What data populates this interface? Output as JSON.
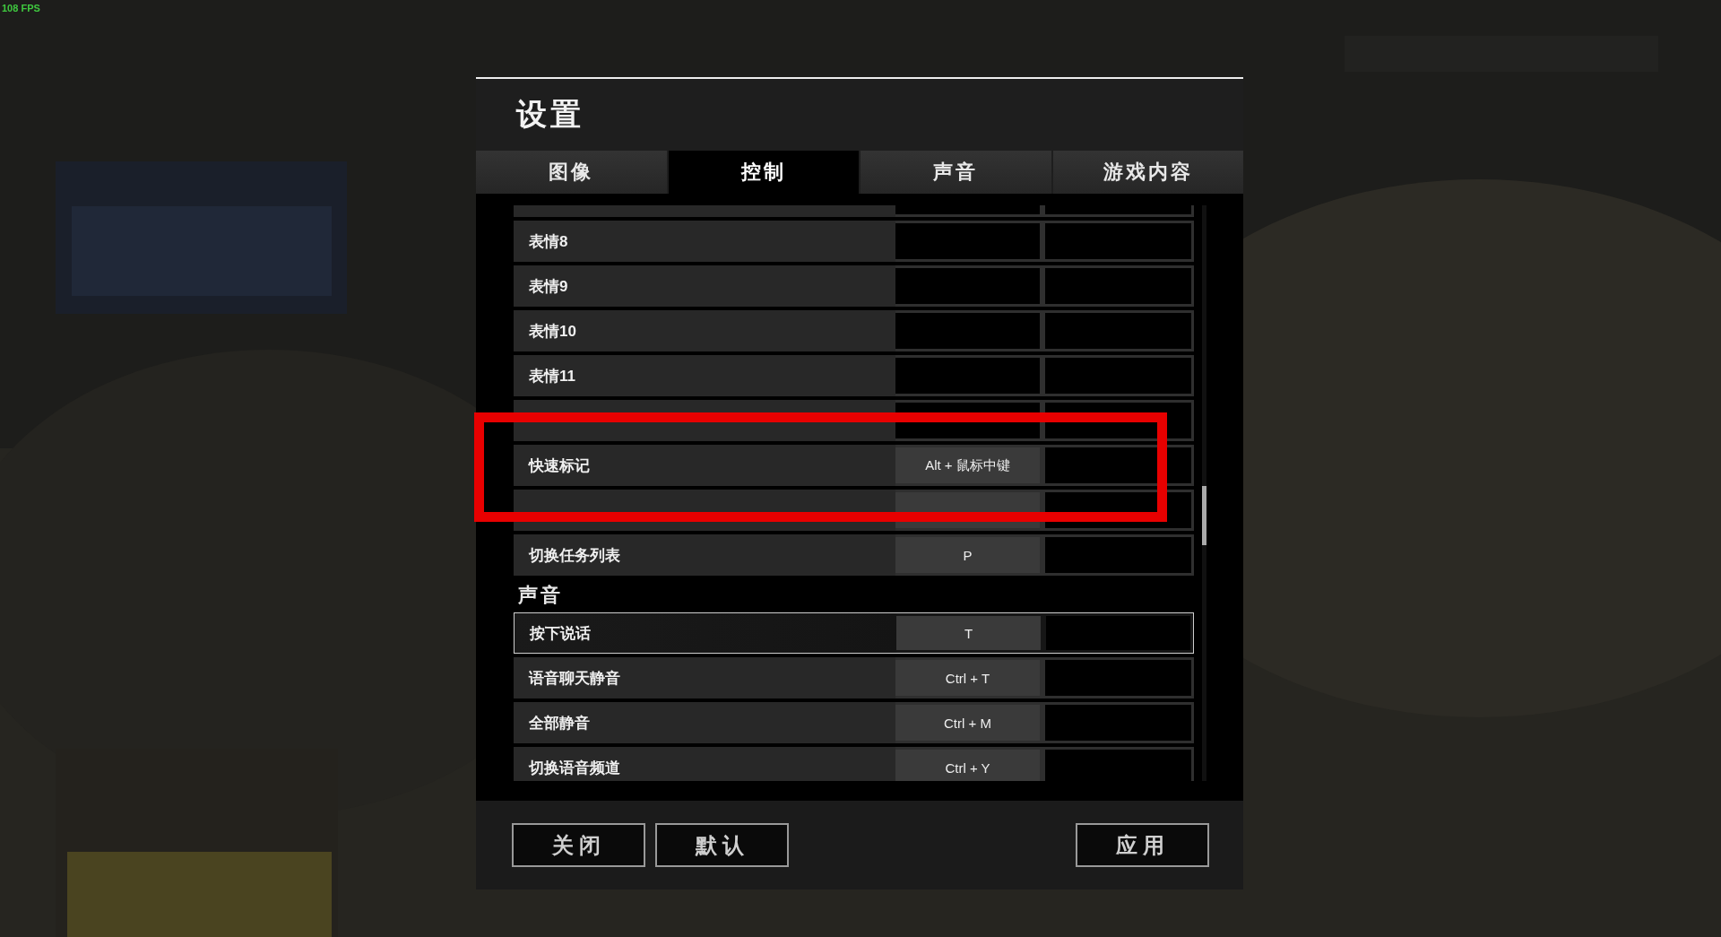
{
  "fps_counter": "108 FPS",
  "dialog": {
    "title": "设置",
    "tabs": [
      {
        "label": "图像",
        "selected": false
      },
      {
        "label": "控制",
        "selected": true
      },
      {
        "label": "声音",
        "selected": false
      },
      {
        "label": "游戏内容",
        "selected": false
      }
    ],
    "bindings": [
      {
        "kind": "row",
        "label": "表情8",
        "selected": false
      },
      {
        "kind": "row",
        "label": "表情9",
        "selected": false
      },
      {
        "kind": "row",
        "label": "表情10",
        "selected": false
      },
      {
        "kind": "row",
        "label": "表情11",
        "selected": false
      },
      {
        "kind": "row",
        "selected": false
      },
      {
        "kind": "row",
        "label": "快速标记",
        "primary": "Alt + 鼠标中键",
        "selected": false
      },
      {
        "kind": "row",
        "bound": true,
        "selected": false
      },
      {
        "kind": "row",
        "label": "切换任务列表",
        "primary": "P",
        "selected": false
      },
      {
        "kind": "section",
        "label": "声音"
      },
      {
        "kind": "row",
        "label": "按下说话",
        "primary": "T",
        "selected": true
      },
      {
        "kind": "row",
        "label": "语音聊天静音",
        "primary": "Ctrl + T",
        "selected": false
      },
      {
        "kind": "row",
        "label": "全部静音",
        "primary": "Ctrl + M",
        "selected": false
      },
      {
        "kind": "row",
        "label": "切换语音频道",
        "primary": "Ctrl + Y",
        "selected": false
      }
    ],
    "footer": {
      "left": [
        "关闭",
        "默认"
      ],
      "right": [
        "应用"
      ]
    }
  }
}
